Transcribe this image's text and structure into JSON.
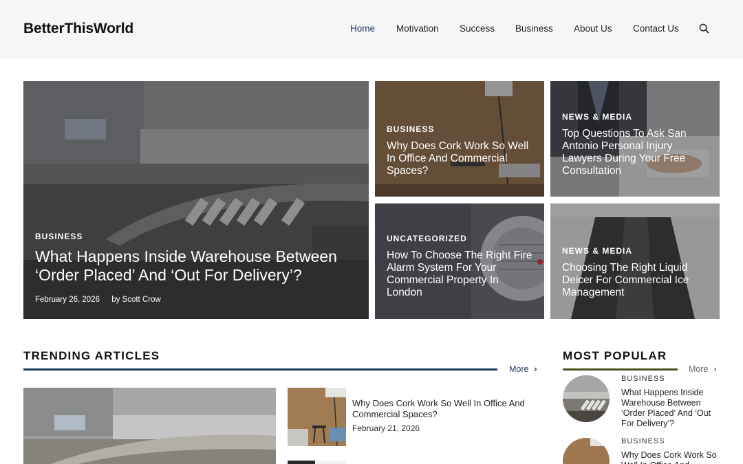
{
  "site": {
    "logo": "BetterThisWorld"
  },
  "nav": {
    "items": [
      {
        "label": "Home"
      },
      {
        "label": "Motivation"
      },
      {
        "label": "Success"
      },
      {
        "label": "Business"
      },
      {
        "label": "About Us"
      },
      {
        "label": "Contact Us"
      }
    ],
    "search_icon": "search-icon"
  },
  "hero": {
    "main": {
      "category": "BUSINESS",
      "title": "What Happens Inside Warehouse Between ‘Order Placed’ And ‘Out For Delivery’?",
      "date": "February 26, 2026",
      "author": "by Scott Crow"
    },
    "cards": [
      {
        "category": "BUSINESS",
        "title": "Why Does Cork Work So Well In Office And Commercial Spaces?"
      },
      {
        "category": "NEWS & MEDIA",
        "title": "Top Questions To Ask San Antonio Personal Injury Lawyers During Your Free Consultation"
      },
      {
        "category": "UNCATEGORIZED",
        "title": "How To Choose The Right Fire Alarm System For Your Commercial Property In London"
      },
      {
        "category": "NEWS & MEDIA",
        "title": "Choosing The Right Liquid Deicer For Commercial Ice Management"
      }
    ]
  },
  "trending": {
    "heading": "TRENDING ARTICLES",
    "more": "More",
    "items": [
      {
        "title": "Why Does Cork Work So Well In Office And Commercial Spaces?",
        "date": "February 21, 2026"
      }
    ]
  },
  "popular": {
    "heading": "MOST POPULAR",
    "more": "More",
    "items": [
      {
        "category": "BUSINESS",
        "title": "What Happens Inside Warehouse Between ‘Order Placed’ And ‘Out For Delivery’?"
      },
      {
        "category": "BUSINESS",
        "title": "Why Does Cork Work So Well In Office And"
      }
    ]
  },
  "colors": {
    "accent_blue": "#1e3a5f",
    "popular_line": "#4a4f1e",
    "header_bg": "#f5f6f8"
  }
}
